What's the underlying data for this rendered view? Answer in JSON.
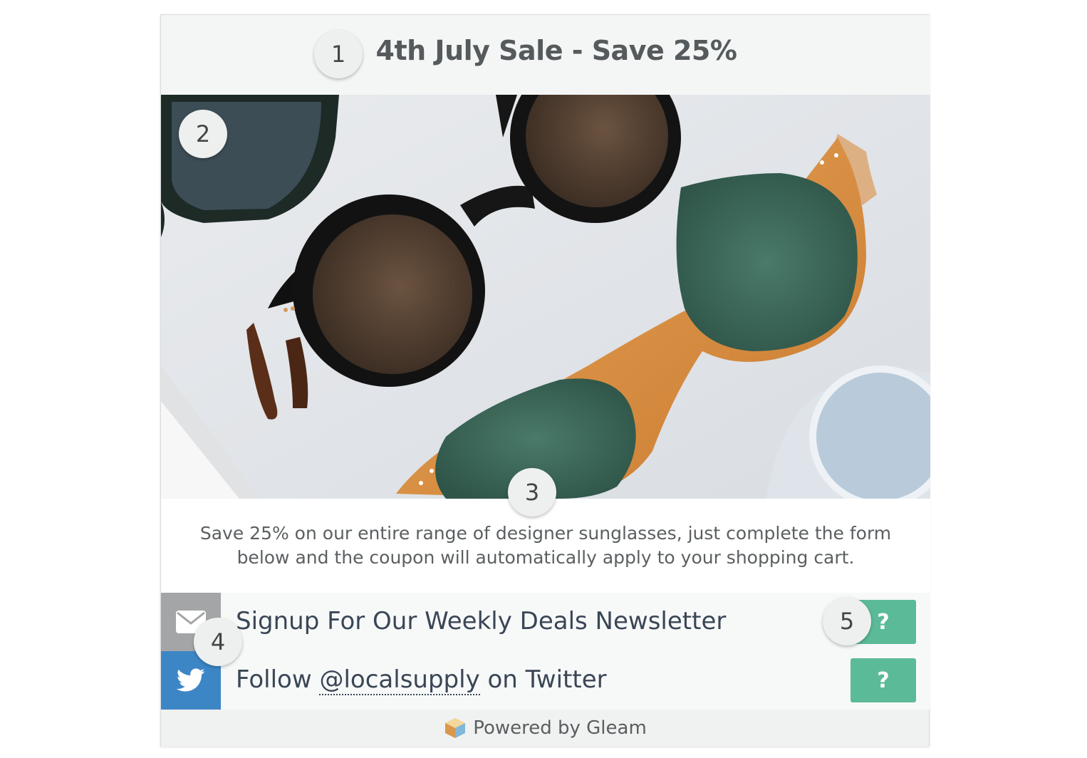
{
  "header": {
    "title": "4th July Sale - Save 25%"
  },
  "badges": [
    "1",
    "2",
    "3",
    "4",
    "5"
  ],
  "hero": {
    "image_description_icon": "sunglasses-photo"
  },
  "description": "Save 25% on our entire range of designer sunglasses, just complete the form below and the coupon will automatically apply to your shopping cart.",
  "entries": [
    {
      "icon": "envelope-icon",
      "label": "Signup For Our Weekly Deals Newsletter",
      "help_label": "?",
      "icon_bg": "#a3a5a6"
    },
    {
      "icon": "twitter-icon",
      "label_prefix": "Follow ",
      "handle": "@localsupply",
      "label_suffix": " on Twitter",
      "help_label": "?",
      "icon_bg": "#3d86c6"
    }
  ],
  "footer": {
    "text": "Powered by Gleam",
    "icon": "gleam-logo-icon"
  },
  "colors": {
    "accent_green": "#5bba97",
    "twitter_blue": "#3d86c6",
    "title_gray": "#555a5c"
  }
}
